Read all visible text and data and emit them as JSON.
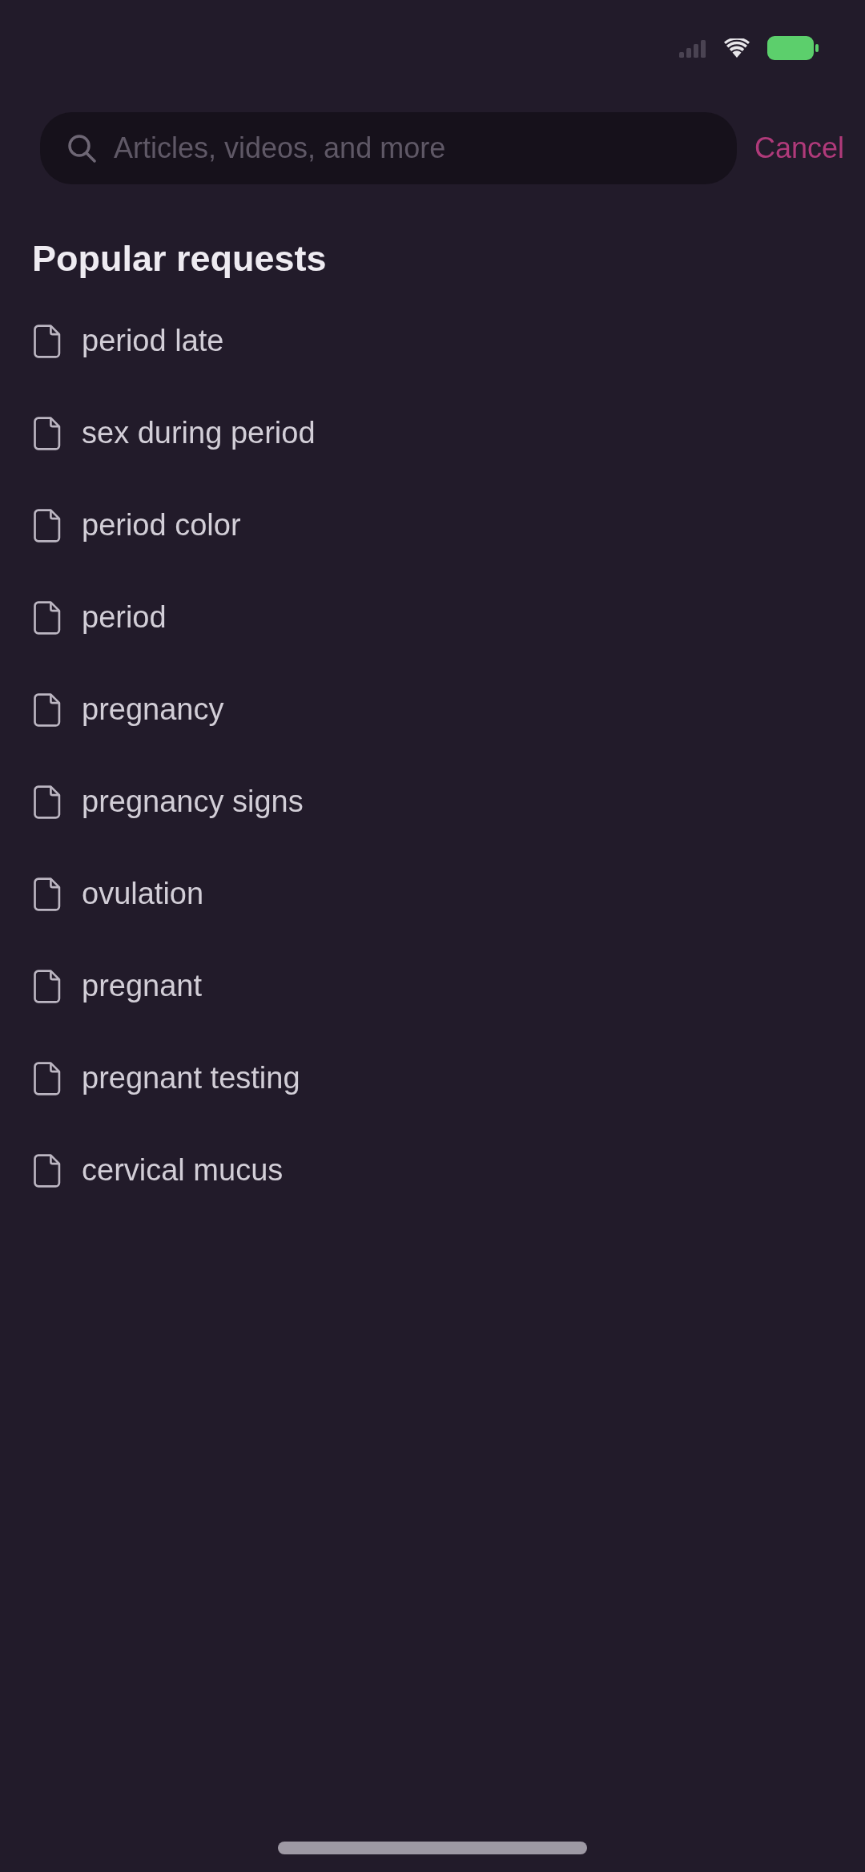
{
  "search": {
    "placeholder": "Articles, videos, and more",
    "cancel": "Cancel"
  },
  "popular": {
    "title": "Popular requests",
    "items": [
      "period late",
      "sex during period",
      "period color",
      "period",
      "pregnancy",
      "pregnancy signs",
      "ovulation",
      "pregnant",
      "pregnant testing",
      "cervical mucus"
    ]
  }
}
